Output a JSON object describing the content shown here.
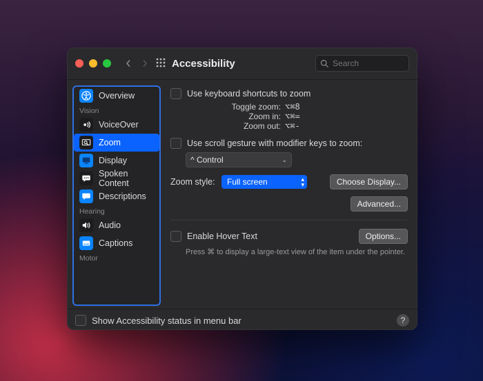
{
  "toolbar": {
    "title": "Accessibility",
    "search_placeholder": "Search"
  },
  "sidebar": {
    "sections": [
      {
        "label": null,
        "items": [
          {
            "key": "overview",
            "label": "Overview"
          }
        ]
      },
      {
        "label": "Vision",
        "items": [
          {
            "key": "voiceover",
            "label": "VoiceOver"
          },
          {
            "key": "zoom",
            "label": "Zoom",
            "selected": true
          },
          {
            "key": "display",
            "label": "Display"
          },
          {
            "key": "spoken",
            "label": "Spoken Content"
          },
          {
            "key": "descriptions",
            "label": "Descriptions"
          }
        ]
      },
      {
        "label": "Hearing",
        "items": [
          {
            "key": "audio",
            "label": "Audio"
          },
          {
            "key": "captions",
            "label": "Captions"
          }
        ]
      },
      {
        "label": "Motor",
        "items": []
      }
    ]
  },
  "main": {
    "kb_checkbox": "Use keyboard shortcuts to zoom",
    "kb_lines": [
      {
        "label": "Toggle zoom:",
        "shortcut": "⌥⌘8"
      },
      {
        "label": "Zoom in:",
        "shortcut": "⌥⌘="
      },
      {
        "label": "Zoom out:",
        "shortcut": "⌥⌘-"
      }
    ],
    "scroll_checkbox": "Use scroll gesture with modifier keys to zoom:",
    "modifier_value": "^ Control",
    "zoom_style_label": "Zoom style:",
    "zoom_style_value": "Full screen",
    "choose_display_btn": "Choose Display...",
    "advanced_btn": "Advanced...",
    "hover_checkbox": "Enable Hover Text",
    "options_btn": "Options...",
    "hover_hint": "Press ⌘ to display a large-text view of the item under the pointer."
  },
  "footer": {
    "menubar_checkbox": "Show Accessibility status in menu bar"
  }
}
